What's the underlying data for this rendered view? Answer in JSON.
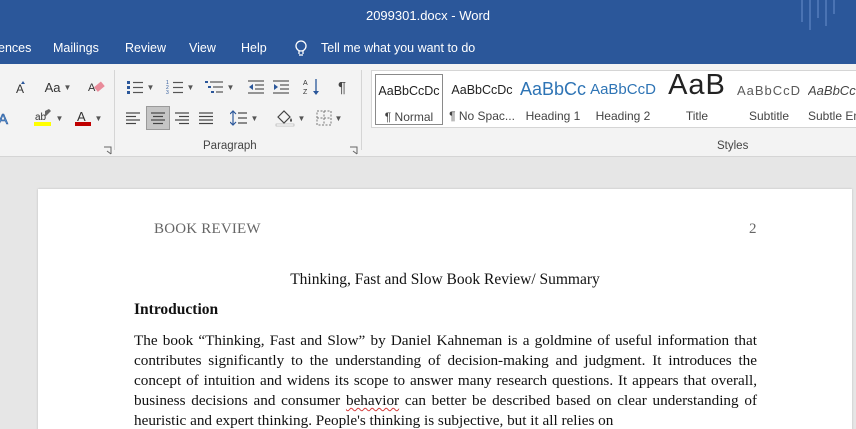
{
  "titlebar": {
    "title": "2099301.docx  -  Word"
  },
  "tabs": [
    {
      "label": "ences"
    },
    {
      "label": "Mailings"
    },
    {
      "label": "Review"
    },
    {
      "label": "View"
    },
    {
      "label": "Help"
    }
  ],
  "tellme": {
    "label": "Tell me what you want to do"
  },
  "ribbon": {
    "font_group": {
      "change_case_label": "Aa"
    },
    "paragraph_group": {
      "label": "Paragraph"
    },
    "styles_group": {
      "label": "Styles",
      "items": [
        {
          "preview": "AaBbCcDc",
          "name": "¶ Normal",
          "selected": true
        },
        {
          "preview": "AaBbCcDc",
          "name": "¶ No Spac..."
        },
        {
          "preview": "AaBbCc",
          "name": "Heading 1"
        },
        {
          "preview": "AaBbCcD",
          "name": "Heading 2"
        },
        {
          "preview": "AaB",
          "name": "Title"
        },
        {
          "preview": "AaBbCcD",
          "name": "Subtitle"
        },
        {
          "preview": "AaBbCcD",
          "name": "Subtle Em"
        }
      ]
    }
  },
  "document": {
    "header_left": "BOOK REVIEW",
    "header_right": "2",
    "title": "Thinking, Fast and Slow Book Review/ Summary",
    "heading": "Introduction",
    "paragraph_before": "The book “Thinking, Fast and Slow” by Daniel Kahneman is a goldmine of useful information that contributes significantly to the understanding of decision-making and judgment. It introduces the concept of intuition and widens its scope to answer many research questions. It appears that overall, business decisions and consumer ",
    "paragraph_flagged": "behavior",
    "paragraph_after": " can better be described based on clear understanding of heuristic and expert thinking. People's thinking is subjective, but it all relies on"
  },
  "colors": {
    "title_bar": "#2b579a",
    "ribbon_bg": "#f3f3f3",
    "canvas_bg": "#e6e6e6",
    "heading_blue": "#2e74b5",
    "font_color_red": "#c00000",
    "highlight_yellow": "#ffff00",
    "spellcheck_red": "#d43b3b"
  }
}
